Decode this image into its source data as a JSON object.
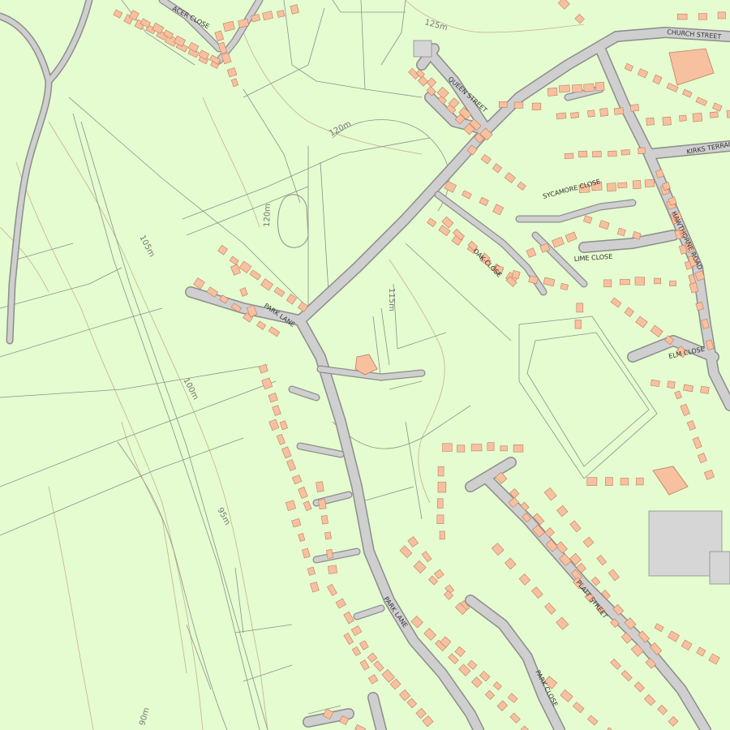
{
  "colors": {
    "background": "#e4fccf",
    "road_fill": "#cfcfcf",
    "road_edge": "#8d8d8d",
    "building": "#f7c1a0",
    "building_edge": "#c07a60",
    "parcel_line": "#8f8f8f",
    "contour": "#c9b08a",
    "large_building": "#d6d6d6"
  },
  "street_labels": [
    "ACER CLOSE",
    "CHURCH STREET",
    "QUEEN STREET",
    "KIRKS TERRACE",
    "SYCAMORE CLOSE",
    "HAWTHORNE ROAD",
    "OAK CLOSE",
    "LIME CLOSE",
    "PARK LANE",
    "ELM CLOSE",
    "PARK LANE",
    "PLATT STREET",
    "PARK CLOSE"
  ],
  "contour_labels": [
    "125m",
    "120m",
    "120m",
    "115m",
    "105m",
    "100m",
    "95m",
    "90m"
  ]
}
